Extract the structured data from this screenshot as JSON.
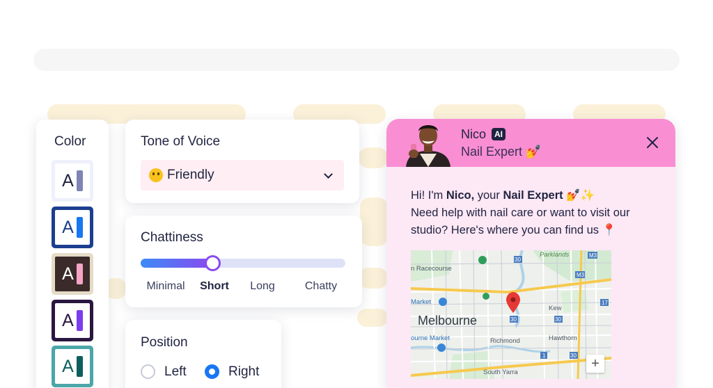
{
  "color_panel": {
    "title": "Color",
    "swatches": [
      {
        "letter": "A",
        "frame": "#eef1fb",
        "bg": "#ffffff",
        "text": "#1f2340",
        "bar": "#7f84b4",
        "selected": false
      },
      {
        "letter": "A",
        "frame": "#1b3e8f",
        "bg": "#ffffff",
        "text": "#1b3e8f",
        "bar": "#1877f2",
        "selected": false
      },
      {
        "letter": "A",
        "frame": "#e5dbc6",
        "bg": "#3a2a2a",
        "text": "#ffffff",
        "bar": "#f6a4c6",
        "selected": false
      },
      {
        "letter": "A",
        "frame": "#2a1740",
        "bg": "#ffffff",
        "text": "#2a1740",
        "bar": "#7a3df0",
        "selected": false
      },
      {
        "letter": "A",
        "frame": "#4ba6a8",
        "bg": "#ffffff",
        "text": "#0f5e5e",
        "bar": "#0f5e5e",
        "selected": false
      }
    ]
  },
  "tone": {
    "title": "Tone of Voice",
    "selected": "Friendly",
    "emoji_icon": "smiling-face-icon"
  },
  "chattiness": {
    "title": "Chattiness",
    "options": [
      "Minimal",
      "Short",
      "Long",
      "Chatty"
    ],
    "selected": "Short",
    "level": 0.35
  },
  "position": {
    "title": "Position",
    "options": [
      "Left",
      "Right"
    ],
    "selected": "Right"
  },
  "chat_widget": {
    "name": "Nico",
    "badge": "AI",
    "role": "Nail Expert 💅",
    "message": {
      "greeting_prefix": "Hi! I'm ",
      "name": "Nico,",
      "mid": " your ",
      "role": "Nail Expert",
      "greeting_suffix": " 💅✨",
      "line2": "Need help with nail care or want to visit our studio? Here's where you can find us 📍"
    },
    "header_color": "#f98ed3",
    "body_color": "#fde8f5",
    "map": {
      "city": "Melbourne",
      "labels": [
        "Parklands",
        "n Racecourse",
        "Market",
        "Kew",
        "Richmond",
        "Hawthorn",
        "ourne Market",
        "South Yarra"
      ],
      "route_markers": [
        "M3",
        "M3",
        "17",
        "30",
        "30",
        "30",
        "1",
        "30"
      ],
      "zoom_button": "+"
    }
  }
}
